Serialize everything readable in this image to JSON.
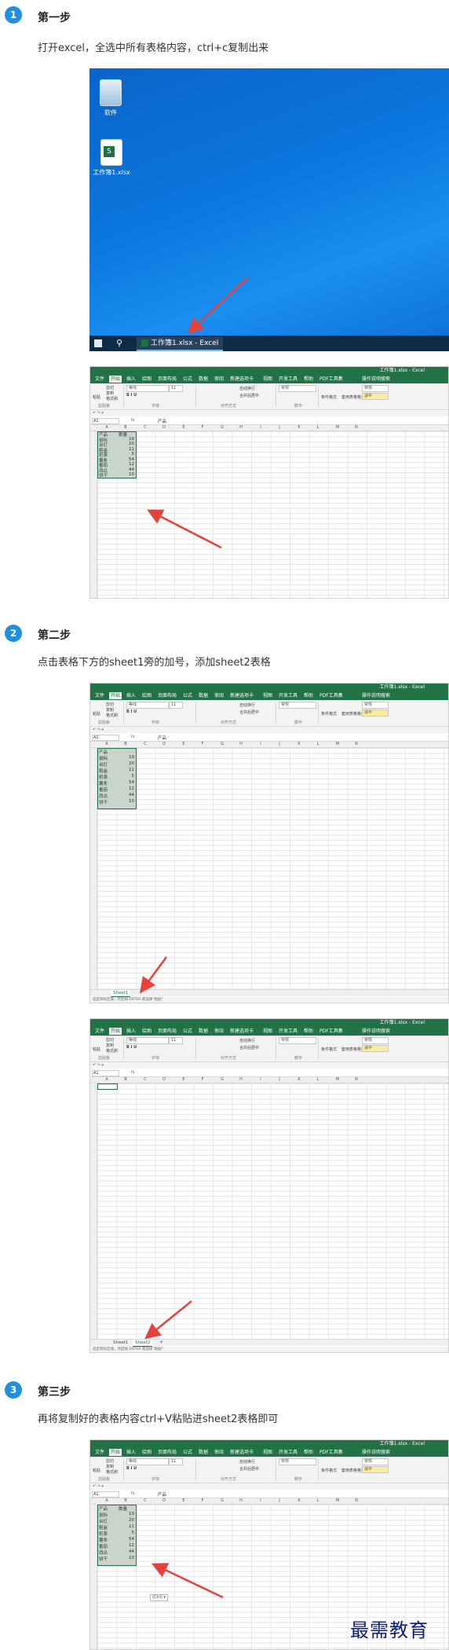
{
  "steps": [
    {
      "number": "1",
      "title": "第一步",
      "desc": "打开excel，全选中所有表格内容，ctrl+c复制出来"
    },
    {
      "number": "2",
      "title": "第二步",
      "desc": "点击表格下方的sheet1旁的加号，添加sheet2表格"
    },
    {
      "number": "3",
      "title": "第三步",
      "desc": "再将复制好的表格内容ctrl+V粘贴进sheet2表格即可"
    }
  ],
  "desktop": {
    "icon1_label": "软件",
    "icon2_label": "工作簿1.xlsx",
    "taskbar_app": "工作簿1.xlsx - Excel",
    "search_glyph": "⚲"
  },
  "excel": {
    "window_title": "工作簿1.xlsx - Excel",
    "tabs": [
      "文件",
      "开始",
      "插入",
      "绘图",
      "页面布局",
      "公式",
      "数据",
      "审阅",
      "新建选项卡",
      "视图",
      "开发工具",
      "帮助",
      "PDF工具集",
      "操作说明搜索"
    ],
    "clipboard": {
      "paste": "粘贴",
      "cut": "剪切",
      "copy": "复制",
      "painter": "格式刷",
      "group": "剪贴板"
    },
    "font": {
      "name": "等线",
      "size": "11",
      "group": "字体"
    },
    "align": {
      "wrap": "自动换行",
      "merge": "合并后居中",
      "group": "对齐方式"
    },
    "number": {
      "format": "常规",
      "group": "数字"
    },
    "styles": {
      "cond": "条件格式",
      "table": "套用表格格式",
      "normal": "常规",
      "bad": "差",
      "good": "适中"
    },
    "quick_access": "↶ ↷ ▾",
    "name_box": "A1",
    "fx": "fx",
    "formula_value": "产品",
    "formula_value_empty": "",
    "columns": [
      "A",
      "B",
      "C",
      "D",
      "E",
      "F",
      "G",
      "H",
      "I",
      "J",
      "K",
      "L",
      "M",
      "N"
    ],
    "table_header": [
      "产品",
      "数量"
    ],
    "table_rows": [
      [
        "鼠标",
        "19"
      ],
      [
        "台灯",
        "20"
      ],
      [
        "鞋盒",
        "11"
      ],
      [
        "奶茶",
        "5"
      ],
      [
        "薯条",
        "54"
      ],
      [
        "番茄",
        "12"
      ],
      [
        "西瓜",
        "44"
      ],
      [
        "饼干",
        "10"
      ]
    ],
    "sheet1": "Sheet1",
    "sheet2": "Sheet2",
    "add_sheet": "+",
    "status_text": "选定目标区域，然后按 ENTER 或选择“粘贴”",
    "paste_ctrl": "(Ctrl) ▾"
  },
  "watermark": "最需教育",
  "colors": {
    "accent": "#1e8fe1",
    "excel_green": "#217346",
    "arrow": "#e8403a"
  }
}
